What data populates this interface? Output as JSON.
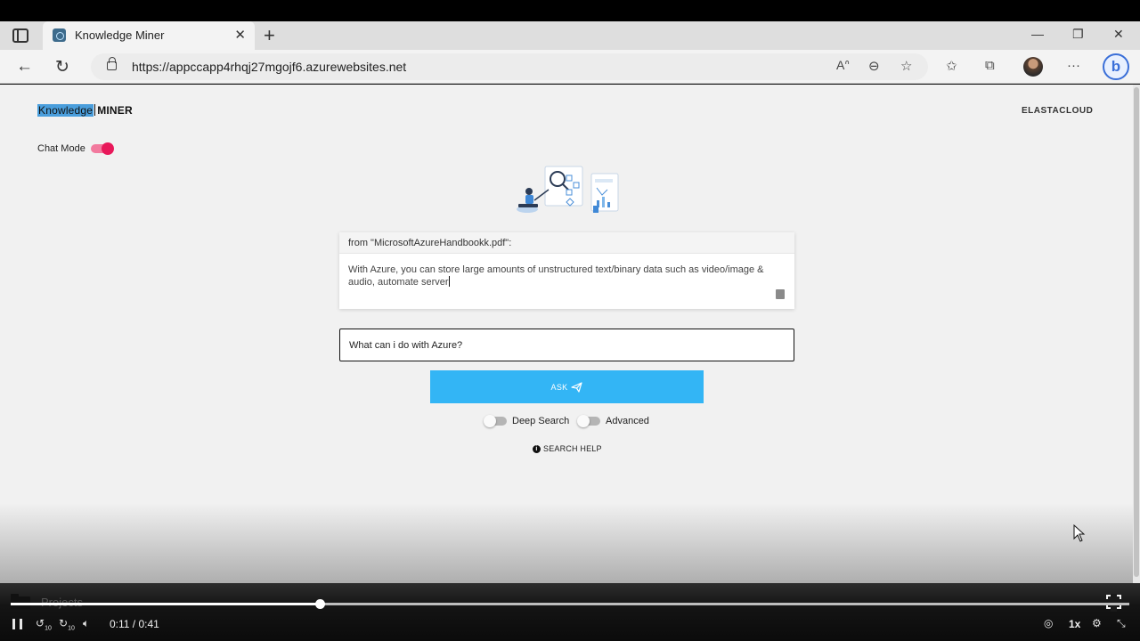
{
  "browser": {
    "tab_title": "Knowledge Miner",
    "url": "https://appccapp4rhqj27mgojf6.azurewebsites.net"
  },
  "header": {
    "logo_highlighted": "Knowledge",
    "logo_rest": "MINER",
    "brand": "ELASTACLOUD"
  },
  "chat_mode": {
    "label": "Chat Mode",
    "enabled": true
  },
  "answer": {
    "source": "from \"MicrosoftAzureHandbookk.pdf\":",
    "text": "With Azure, you can store large amounts of unstructured text/binary data such as video/image & audio, automate server"
  },
  "query": {
    "value": "What can i do with Azure?"
  },
  "ask_button": {
    "label": "ASK"
  },
  "options": {
    "deep_search": {
      "label": "Deep Search",
      "enabled": false
    },
    "advanced": {
      "label": "Advanced",
      "enabled": false
    }
  },
  "search_help": {
    "label": "SEARCH HELP"
  },
  "player": {
    "folder_label": "Projects",
    "time": "0:11 / 0:41",
    "progress": 0.276,
    "speed": "1x",
    "rewind_label": "10",
    "forward_label": "10"
  },
  "colors": {
    "accent_pink": "#e8185a",
    "ask_blue": "#33b5f5",
    "logo_highlight": "#4a9edc"
  }
}
